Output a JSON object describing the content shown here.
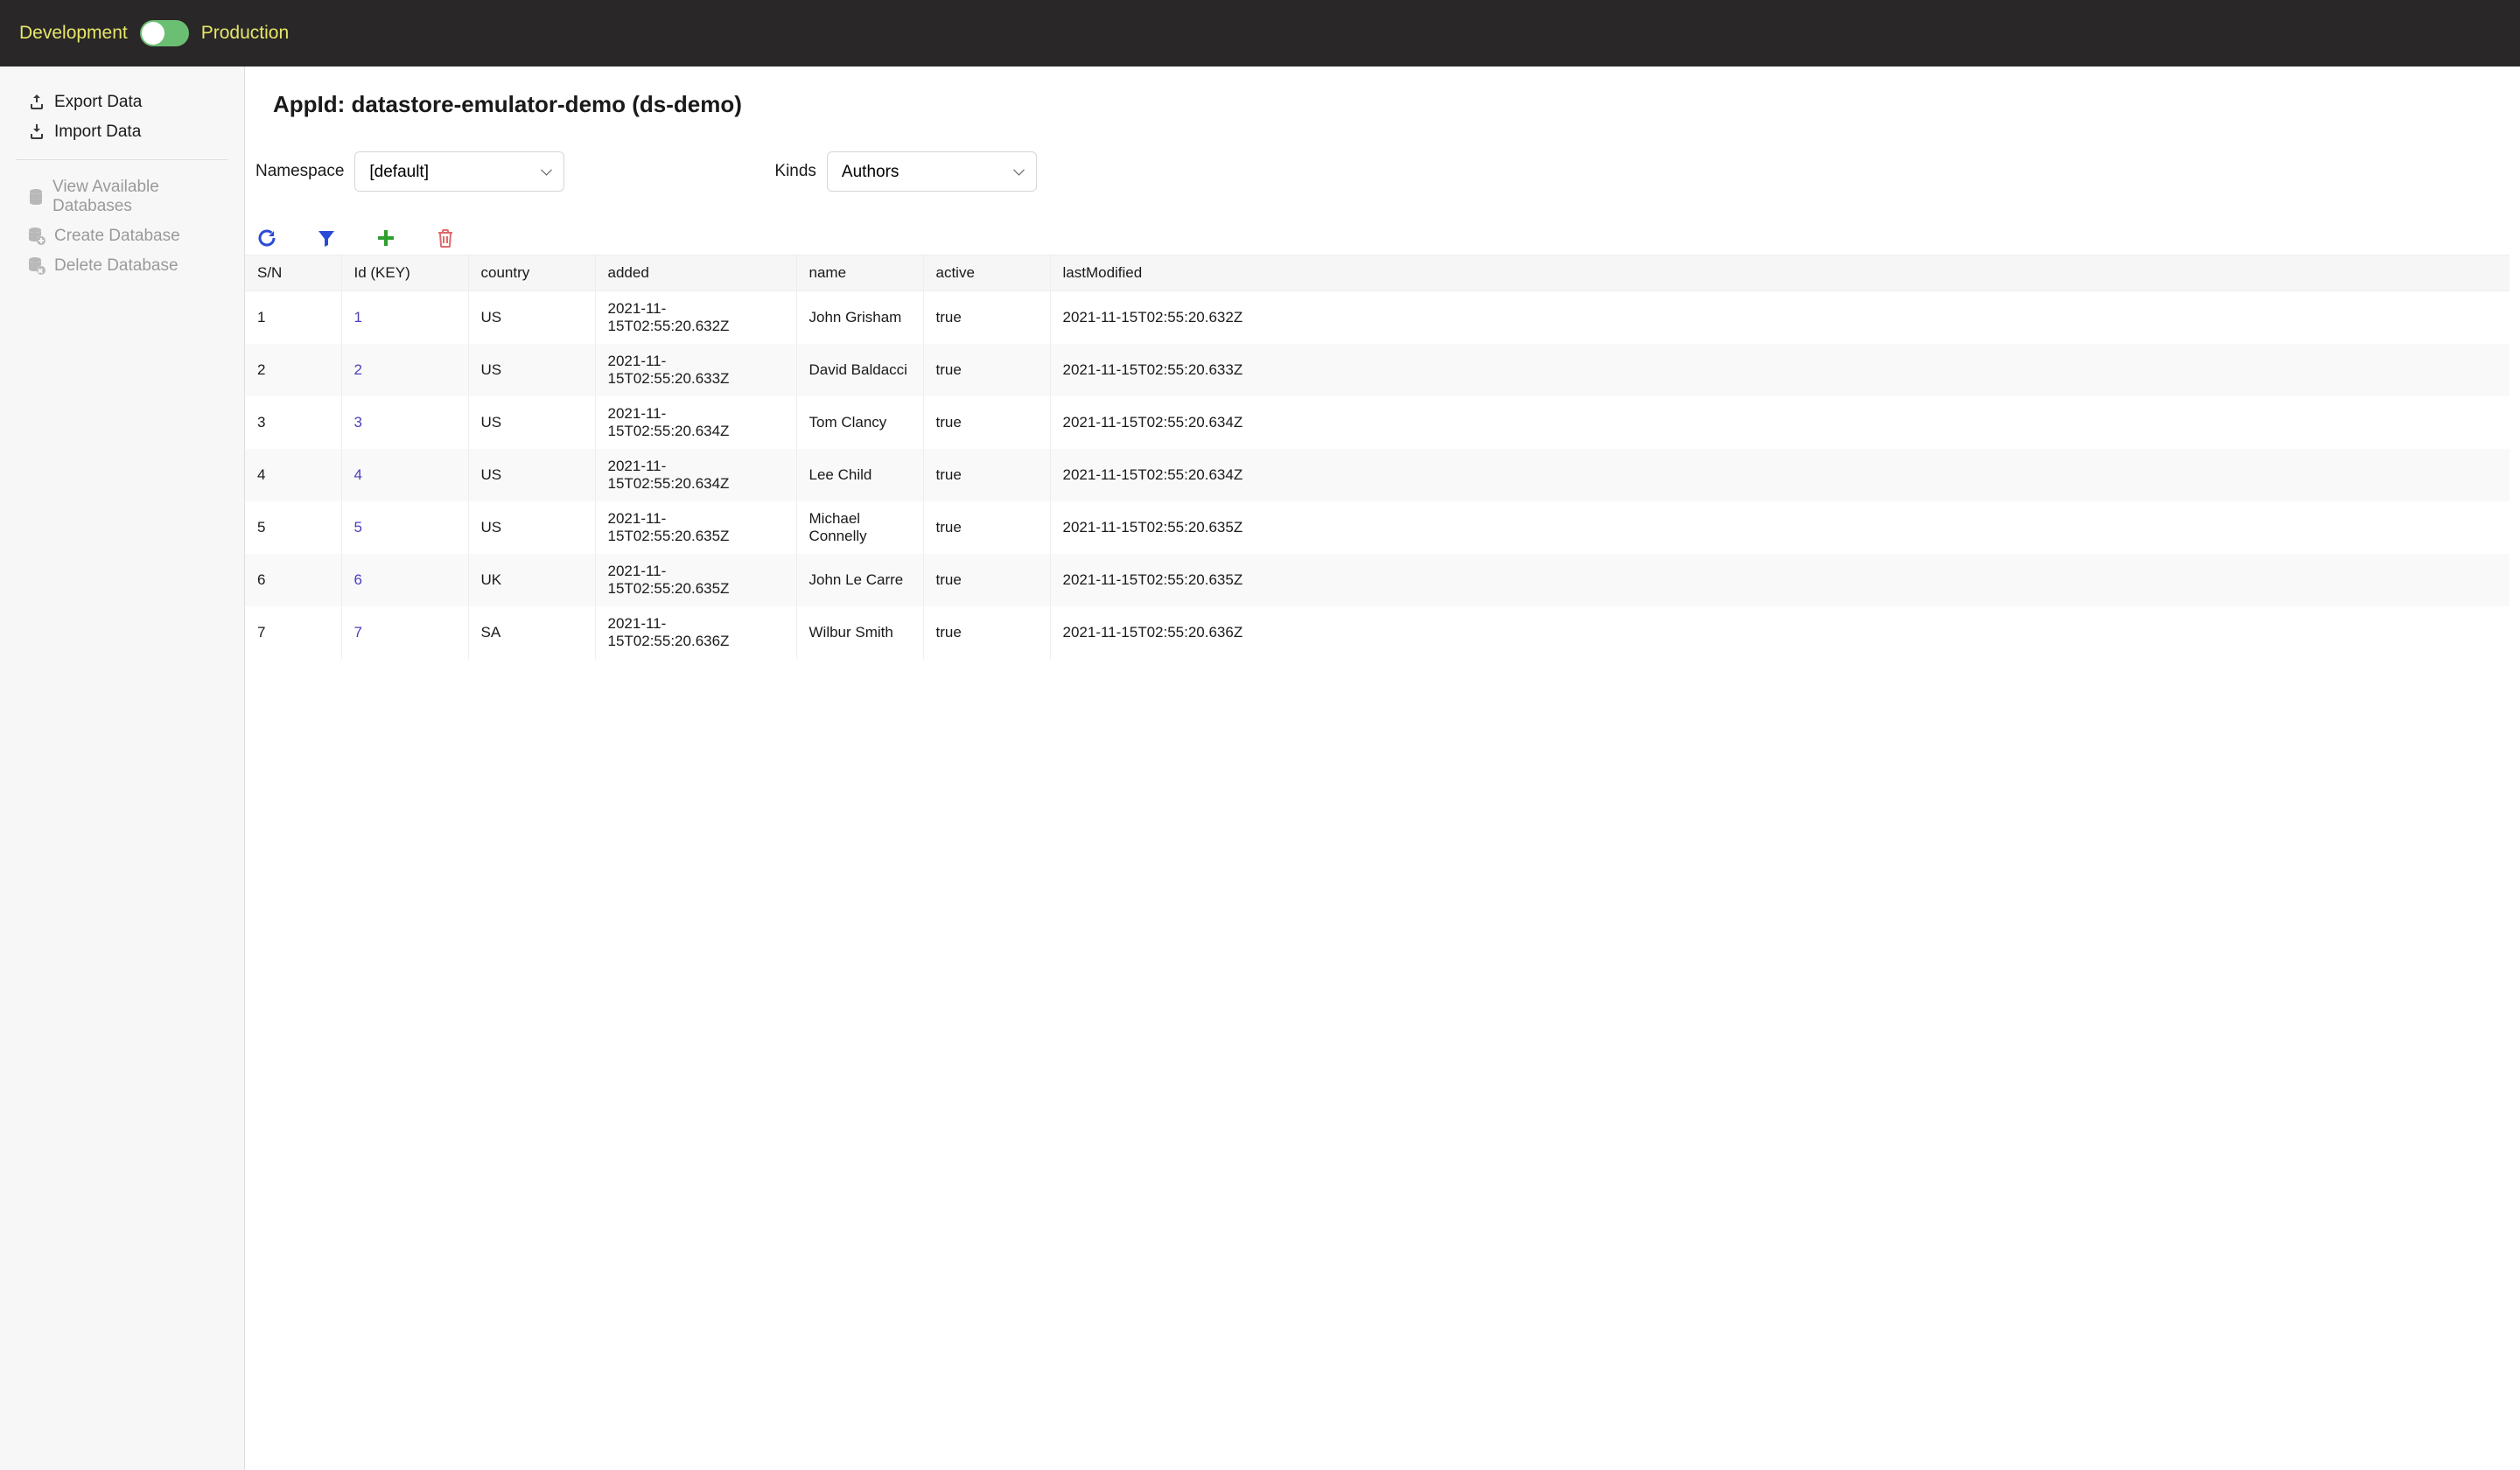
{
  "topbar": {
    "dev_label": "Development",
    "prod_label": "Production"
  },
  "sidebar": {
    "export": "Export Data",
    "import": "Import Data",
    "view_db": "View Available Databases",
    "create_db": "Create Database",
    "delete_db": "Delete Database"
  },
  "page": {
    "title": "AppId: datastore-emulator-demo (ds-demo)"
  },
  "controls": {
    "namespace_label": "Namespace",
    "namespace_value": "[default]",
    "kinds_label": "Kinds",
    "kinds_value": "Authors"
  },
  "table": {
    "headers": {
      "sn": "S/N",
      "id": "Id (KEY)",
      "country": "country",
      "added": "added",
      "name": "name",
      "active": "active",
      "lastModified": "lastModified"
    },
    "rows": [
      {
        "sn": "1",
        "id": "1",
        "country": "US",
        "added": "2021-11-15T02:55:20.632Z",
        "name": "John Grisham",
        "active": "true",
        "lastModified": "2021-11-15T02:55:20.632Z"
      },
      {
        "sn": "2",
        "id": "2",
        "country": "US",
        "added": "2021-11-15T02:55:20.633Z",
        "name": "David Baldacci",
        "active": "true",
        "lastModified": "2021-11-15T02:55:20.633Z"
      },
      {
        "sn": "3",
        "id": "3",
        "country": "US",
        "added": "2021-11-15T02:55:20.634Z",
        "name": "Tom Clancy",
        "active": "true",
        "lastModified": "2021-11-15T02:55:20.634Z"
      },
      {
        "sn": "4",
        "id": "4",
        "country": "US",
        "added": "2021-11-15T02:55:20.634Z",
        "name": "Lee Child",
        "active": "true",
        "lastModified": "2021-11-15T02:55:20.634Z"
      },
      {
        "sn": "5",
        "id": "5",
        "country": "US",
        "added": "2021-11-15T02:55:20.635Z",
        "name": "Michael Connelly",
        "active": "true",
        "lastModified": "2021-11-15T02:55:20.635Z"
      },
      {
        "sn": "6",
        "id": "6",
        "country": "UK",
        "added": "2021-11-15T02:55:20.635Z",
        "name": "John Le Carre",
        "active": "true",
        "lastModified": "2021-11-15T02:55:20.635Z"
      },
      {
        "sn": "7",
        "id": "7",
        "country": "SA",
        "added": "2021-11-15T02:55:20.636Z",
        "name": "Wilbur Smith",
        "active": "true",
        "lastModified": "2021-11-15T02:55:20.636Z"
      }
    ]
  }
}
